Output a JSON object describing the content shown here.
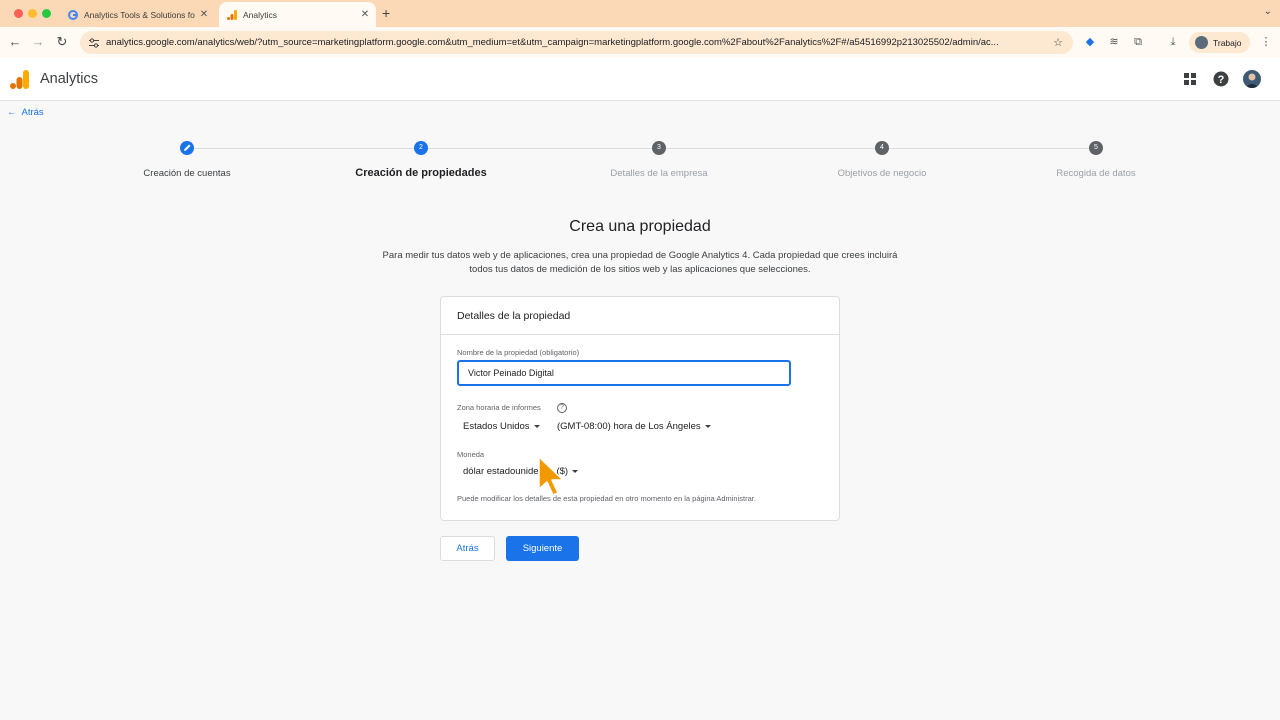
{
  "browser": {
    "tabs": [
      {
        "title": "Analytics Tools & Solutions fo",
        "icon": "google-icon"
      },
      {
        "title": "Analytics",
        "icon": "analytics-icon"
      }
    ],
    "url": "analytics.google.com/analytics/web/?utm_source=marketingplatform.google.com&utm_medium=et&utm_campaign=marketingplatform.google.com%2Fabout%2Fanalytics%2F#/a54516992p213025502/admin/ac...",
    "profile_label": "Trabajo"
  },
  "app": {
    "title": "Analytics",
    "back_link": "Atrás"
  },
  "stepper": {
    "steps": [
      {
        "label": "Creación de cuentas",
        "state": "done",
        "number": ""
      },
      {
        "label": "Creación de propiedades",
        "state": "active",
        "number": "2"
      },
      {
        "label": "Detalles de la empresa",
        "state": "todo",
        "number": "3"
      },
      {
        "label": "Objetivos de negocio",
        "state": "todo",
        "number": "4"
      },
      {
        "label": "Recogida de datos",
        "state": "todo",
        "number": "5"
      }
    ]
  },
  "main": {
    "heading": "Crea una propiedad",
    "intro": "Para medir tus datos web y de aplicaciones, crea una propiedad de Google Analytics 4. Cada propiedad que crees incluirá todos tus datos de medición de los sitios web y las aplicaciones que selecciones."
  },
  "card": {
    "title": "Detalles de la propiedad",
    "property_name_label": "Nombre de la propiedad (obligatorio)",
    "property_name_value": "Victor Peinado Digital",
    "timezone_label": "Zona horaria de informes",
    "country": "Estados Unidos",
    "timezone": "(GMT-08:00) hora de Los Ángeles",
    "currency_label": "Moneda",
    "currency": "dólar estadounidense ($)",
    "footnote": "Puede modificar los detalles de esta propiedad en otro momento en la página Administrar."
  },
  "buttons": {
    "back": "Atrás",
    "next": "Siguiente"
  },
  "colors": {
    "accent": "#1a73e8",
    "tabbar": "#fbd9b6",
    "cursor": "#f29900"
  }
}
